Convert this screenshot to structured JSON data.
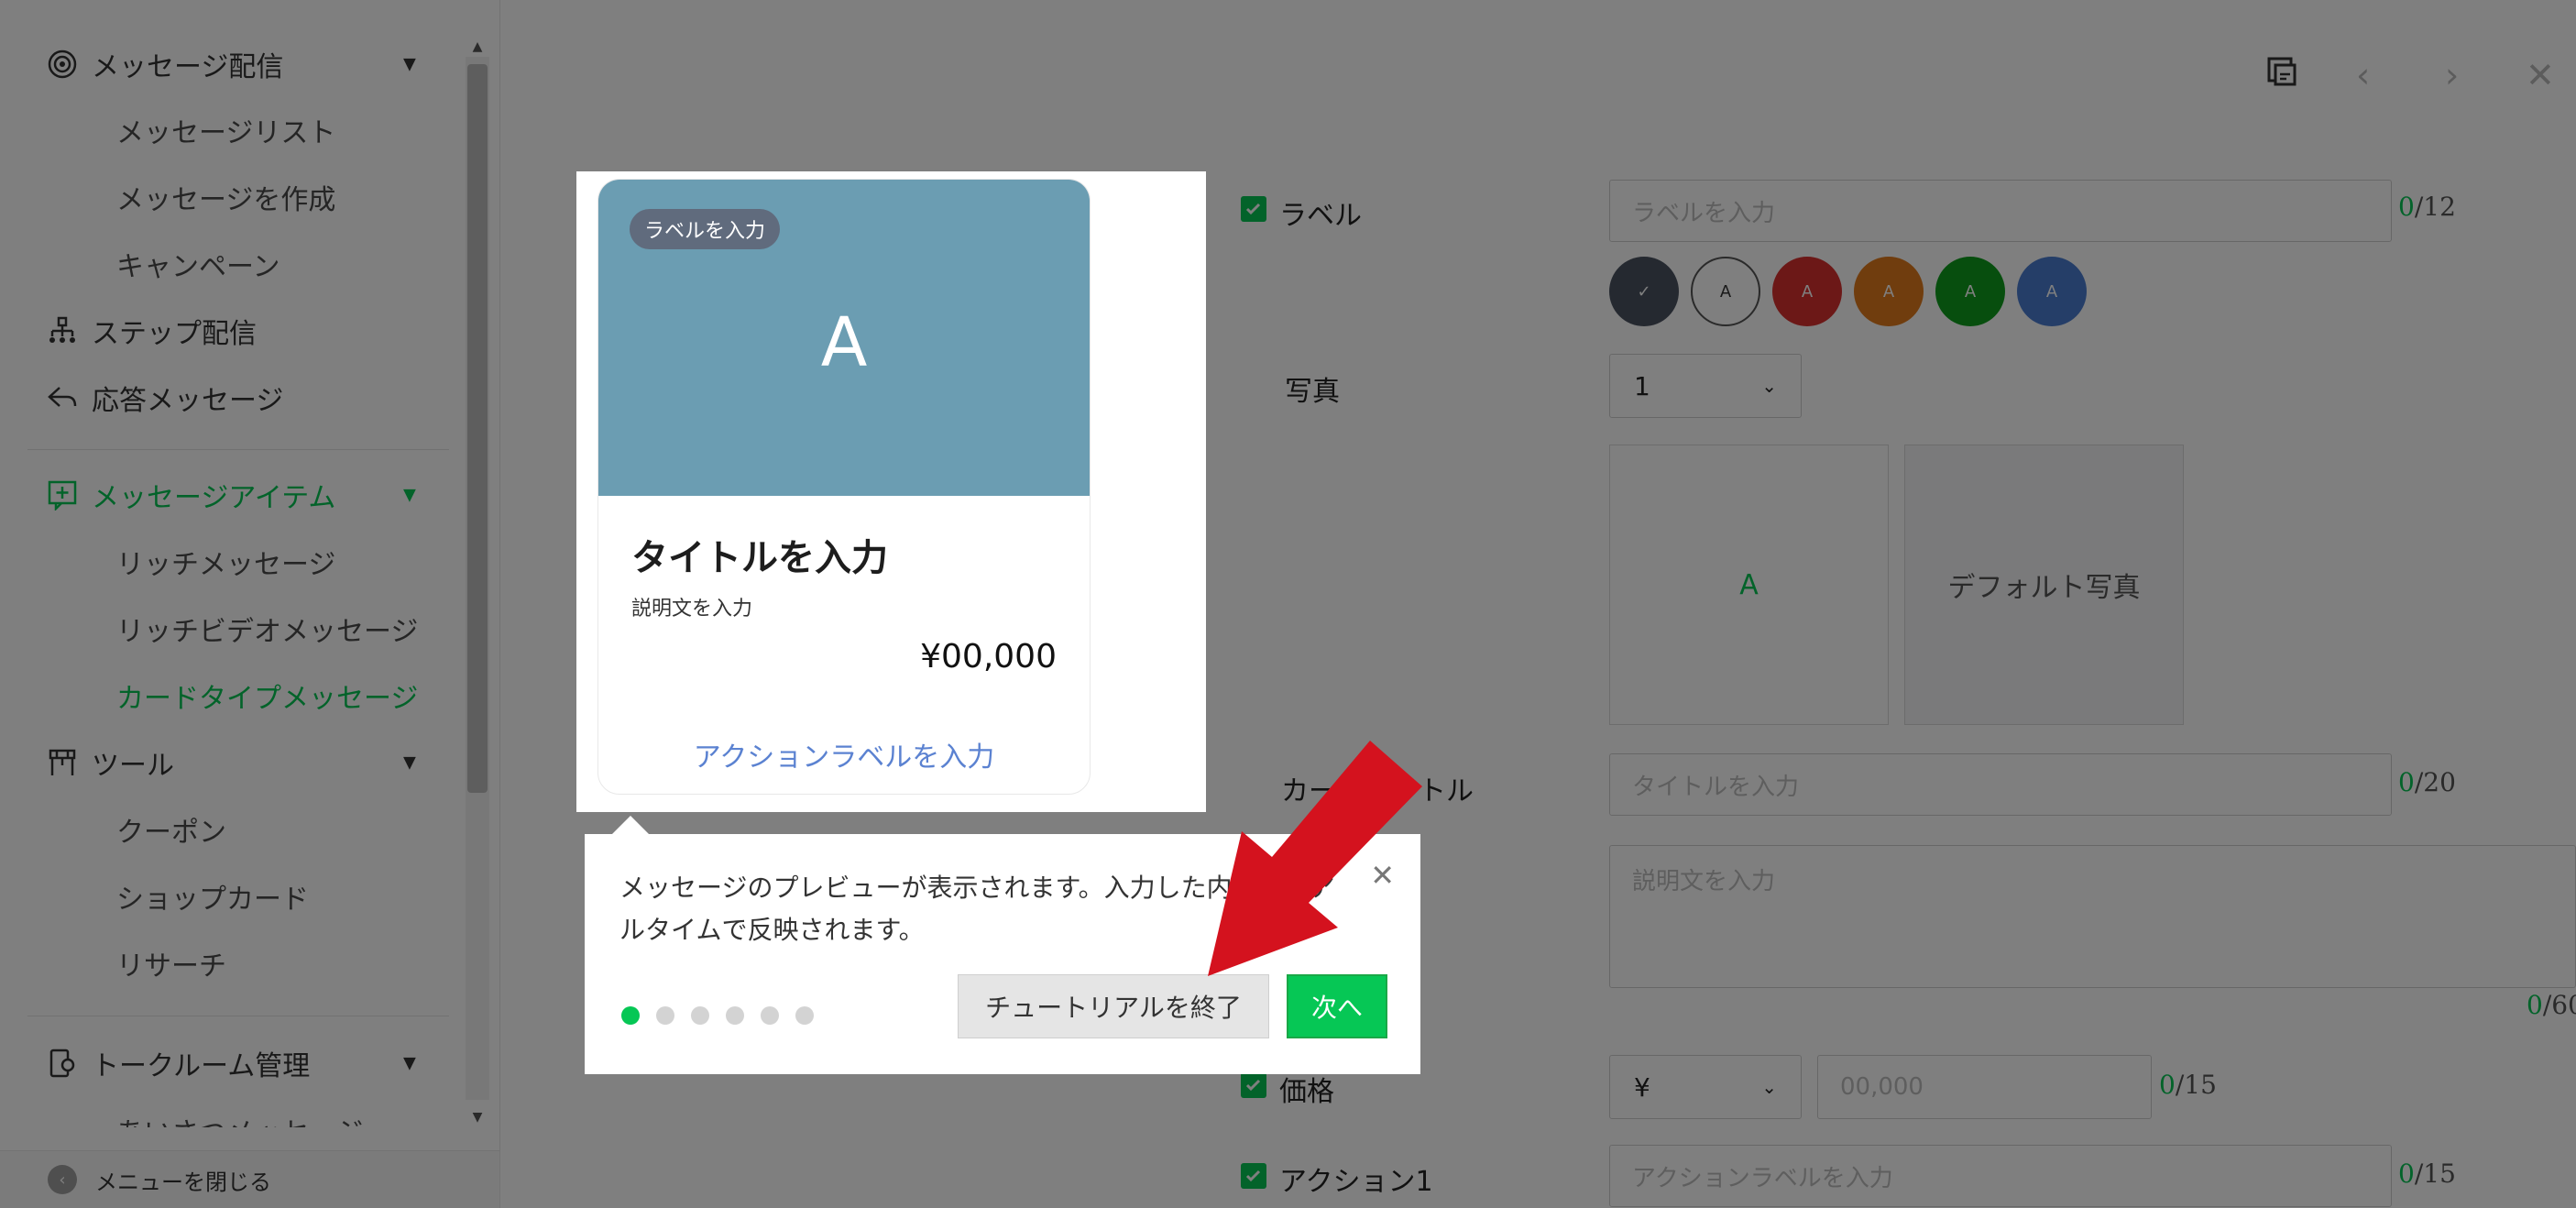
{
  "sidebar": {
    "items": [
      {
        "label": "メッセージ配信",
        "icon": "broadcast-icon"
      },
      {
        "label": "メッセージリスト"
      },
      {
        "label": "メッセージを作成"
      },
      {
        "label": "キャンペーン"
      },
      {
        "label": "ステップ配信",
        "icon": "step-tree-icon"
      },
      {
        "label": "応答メッセージ",
        "icon": "reply-icon"
      },
      {
        "label": "メッセージアイテム",
        "icon": "message-item-icon"
      },
      {
        "label": "リッチメッセージ"
      },
      {
        "label": "リッチビデオメッセージ"
      },
      {
        "label": "カードタイプメッセージ"
      },
      {
        "label": "ツール",
        "icon": "tool-icon"
      },
      {
        "label": "クーポン"
      },
      {
        "label": "ショップカード"
      },
      {
        "label": "リサーチ"
      },
      {
        "label": "トークルーム管理",
        "icon": "chatroom-icon"
      },
      {
        "label": "あいさつメッセージ"
      }
    ],
    "footer_label": "メニューを閉じる",
    "active_item": "カードタイプメッセージ"
  },
  "toolbar": {
    "icons": [
      "copy-icon",
      "prev-icon",
      "next-icon",
      "close-icon"
    ]
  },
  "form": {
    "label_field": {
      "label": "ラベル",
      "placeholder": "ラベルを入力",
      "count": "0",
      "max": "/12"
    },
    "color_swatches": [
      {
        "color": "#4b5261",
        "text": "✓"
      },
      {
        "color": "#ffffff",
        "text": "A"
      },
      {
        "color": "#d8312f",
        "text": "A"
      },
      {
        "color": "#e07a1d",
        "text": "A"
      },
      {
        "color": "#0f9d1d",
        "text": "A"
      },
      {
        "color": "#4a7dd0",
        "text": "A"
      }
    ],
    "photo": {
      "label": "写真",
      "selected": "1",
      "tile_a": "A",
      "tile_default": "デフォルト写真"
    },
    "title_field": {
      "label": "カードタイトル",
      "placeholder": "タイトルを入力",
      "count": "0",
      "max": "/20"
    },
    "desc_field": {
      "placeholder": "説明文を入力",
      "count": "0",
      "max": "/60"
    },
    "price_field": {
      "label": "価格",
      "currency": "¥",
      "placeholder": "00,000",
      "count": "0",
      "max": "/15"
    },
    "action1_field": {
      "label": "アクション1",
      "placeholder": "アクションラベルを入力",
      "count": "0",
      "max": "/15"
    }
  },
  "preview_card": {
    "label": "ラベルを入力",
    "hero_letter": "A",
    "title": "タイトルを入力",
    "description": "説明文を入力",
    "price": "¥00,000",
    "action": "アクションラベルを入力"
  },
  "tutorial": {
    "text": "メッセージのプレビューが表示されます。入力した内容がリアルタイムで反映されます。",
    "end_button": "チュートリアルを終了",
    "next_button": "次へ",
    "steps_total": 6,
    "current_step": 1
  },
  "colors": {
    "accent": "#06c755",
    "link": "#5b82d1",
    "arrow": "#d4121e"
  }
}
